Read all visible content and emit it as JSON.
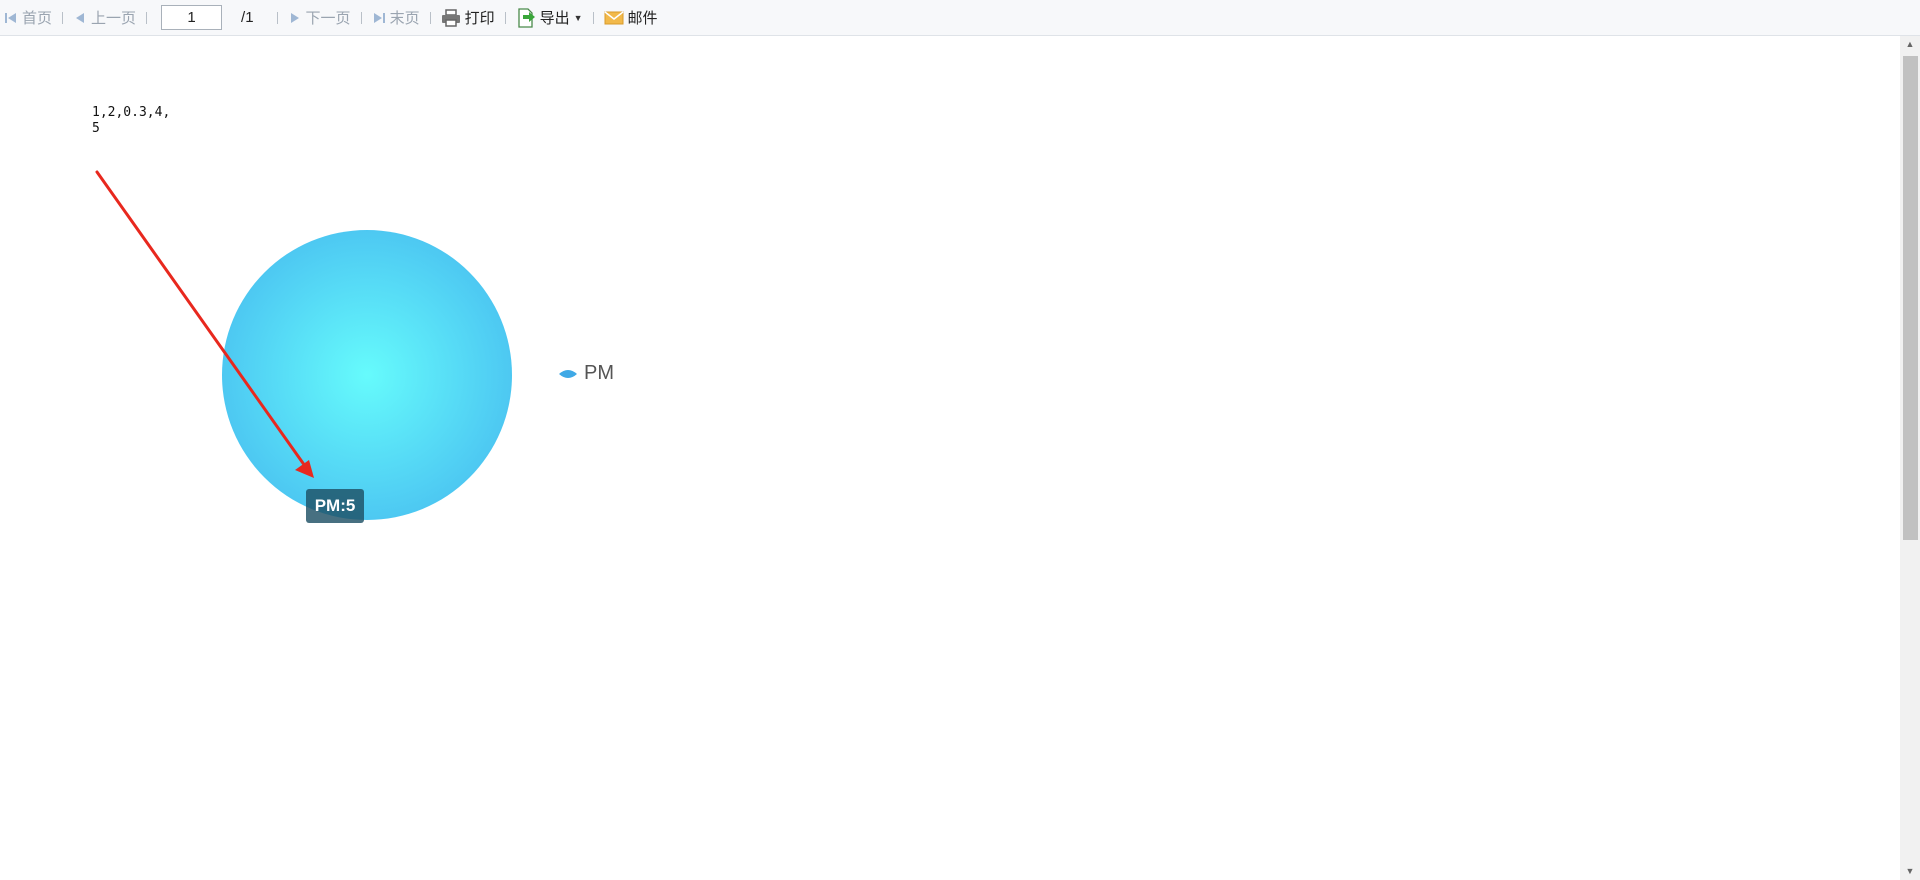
{
  "toolbar": {
    "first": "首页",
    "prev": "上一页",
    "page_value": "1",
    "page_total": "/1",
    "next": "下一页",
    "last": "末页",
    "print": "打印",
    "export": "导出",
    "mail": "邮件"
  },
  "icons": {
    "first": "first-page-icon",
    "prev": "prev-page-icon",
    "next": "next-page-icon",
    "last": "last-page-icon",
    "print": "printer-icon",
    "export": "export-icon",
    "mail": "mail-icon"
  },
  "colors": {
    "pie_center": "#66fbfc",
    "pie_edge": "#4dc8f2",
    "arrow": "#e8281e",
    "legend_marker": "#3fa9e6",
    "tooltip_bg": "#1e5064"
  },
  "annotation_text": "1,2,0.3,4,\n5",
  "chart_data": {
    "type": "pie",
    "title": "",
    "categories": [
      "PM"
    ],
    "values": [
      5
    ],
    "legend": {
      "position": "right",
      "entries": [
        "PM"
      ]
    },
    "tooltip": "PM:5"
  }
}
